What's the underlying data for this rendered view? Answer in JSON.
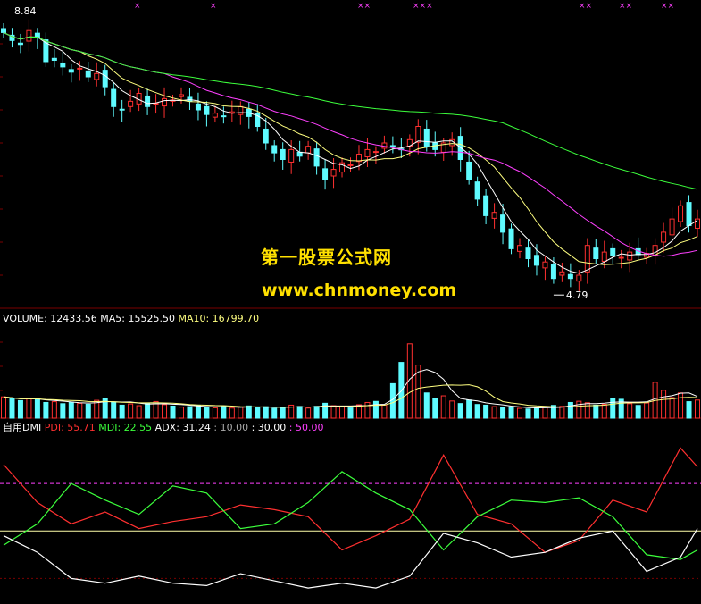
{
  "watermark": {
    "line1": "第一股票公式网",
    "line2": "www.chnmoney.com"
  },
  "colors": {
    "background": "#000000",
    "grid": "#7a0000",
    "up_candle": "#ff3030",
    "down_candle": "#5ffbff",
    "ma_short": "#ffffff",
    "ma_mid": "#ffff80",
    "ma_pink": "#ff40ff",
    "ma_long": "#3cff3c",
    "pdi": "#ff3030",
    "mdi": "#3cff3c",
    "adx": "#ffffff",
    "level_mid": "#ffffaa",
    "level_high": "#ff40ff",
    "level_low": "#ffffff"
  },
  "chart_data": [
    {
      "type": "candlestick",
      "panel": "price",
      "max_label": "8.84",
      "min_label": "4.79",
      "ylim": [
        4.55,
        9.05
      ],
      "grid": true,
      "signal_marks": [
        "×",
        "×",
        "××",
        "×××",
        "××",
        "××",
        "××"
      ],
      "close": [
        8.72,
        8.6,
        8.54,
        8.75,
        8.65,
        8.28,
        8.3,
        8.2,
        8.12,
        8.18,
        8.05,
        8.1,
        7.9,
        7.6,
        7.55,
        7.68,
        7.8,
        7.6,
        7.65,
        7.72,
        7.7,
        7.78,
        7.68,
        7.55,
        7.48,
        7.5,
        7.45,
        7.52,
        7.6,
        7.45,
        7.3,
        7.05,
        6.9,
        6.8,
        6.95,
        6.85,
        7.0,
        6.7,
        6.5,
        6.65,
        6.75,
        6.72,
        6.88,
        6.95,
        6.92,
        7.05,
        7.0,
        6.95,
        7.1,
        7.3,
        7.0,
        6.95,
        7.05,
        7.1,
        6.8,
        6.5,
        6.2,
        5.95,
        6.0,
        5.7,
        5.45,
        5.5,
        5.3,
        5.2,
        5.25,
        5.0,
        5.1,
        5.0,
        5.05,
        5.5,
        5.3,
        5.4,
        5.35,
        5.32,
        5.4,
        5.36,
        5.38,
        5.5,
        5.7,
        5.9,
        6.1,
        5.8,
        5.9
      ],
      "series": [
        {
          "name": "",
          "period": 5
        },
        {
          "name": "",
          "period": 10
        },
        {
          "name": "",
          "period": 20
        },
        {
          "name": "",
          "period": 60
        }
      ]
    },
    {
      "type": "bar",
      "panel": "volume",
      "header": {
        "name": "VOLUME: 12433.56",
        "ma5": "MA5: 15525.50",
        "ma10": "MA10: 16799.70"
      },
      "ylim": [
        0,
        70000
      ],
      "grid": true,
      "values": [
        16000,
        14500,
        13200,
        15100,
        13900,
        11800,
        12400,
        10900,
        12000,
        11200,
        10500,
        13400,
        14800,
        12100,
        9800,
        10700,
        9400,
        11300,
        12500,
        10200,
        9100,
        8300,
        8700,
        9600,
        8100,
        7800,
        8900,
        7600,
        8400,
        9200,
        7900,
        8600,
        7400,
        8100,
        9800,
        8800,
        7600,
        8900,
        11200,
        9400,
        8600,
        7700,
        10100,
        11800,
        12600,
        9900,
        26000,
        42000,
        56000,
        40000,
        19000,
        14500,
        16800,
        12900,
        11000,
        13600,
        10300,
        9800,
        8700,
        7900,
        8600,
        7400,
        6900,
        7800,
        8300,
        9600,
        8900,
        11800,
        12700,
        11600,
        9800,
        10400,
        15000,
        14200,
        10900,
        9600,
        11400,
        27000,
        21000,
        15500,
        19000,
        12400,
        13600
      ],
      "series": [
        {
          "name": "",
          "period": 5
        },
        {
          "name": "",
          "period": 10
        }
      ]
    },
    {
      "type": "line",
      "panel": "dmi",
      "header": {
        "name": "自用DMI",
        "pdi": "PDI: 55.71",
        "mdi": "MDI: 22.55",
        "adx": "ADX: 31.24",
        "level_low": ": 10.00",
        "level_mid": ": 30.00",
        "level_high": ": 50.00"
      },
      "ylim": [
        0,
        70
      ],
      "levels": [
        10,
        30,
        50
      ],
      "x": [
        0,
        4,
        8,
        12,
        16,
        20,
        24,
        28,
        32,
        36,
        40,
        44,
        48,
        52,
        56,
        60,
        64,
        68,
        72,
        76,
        80,
        82
      ],
      "series": [
        {
          "name": "PDI",
          "values": [
            58,
            42,
            33,
            38,
            31,
            34,
            36,
            41,
            39,
            36,
            22,
            28,
            35,
            62,
            37,
            33,
            21,
            26,
            43,
            38,
            65,
            57
          ]
        },
        {
          "name": "MDI",
          "values": [
            24,
            33,
            50,
            43,
            37,
            49,
            46,
            31,
            33,
            42,
            55,
            46,
            39,
            22,
            36,
            43,
            42,
            44,
            36,
            20,
            18,
            22
          ]
        },
        {
          "name": "ADX",
          "values": [
            28,
            21,
            10,
            8,
            11,
            8,
            7,
            12,
            9,
            6,
            8,
            6,
            11,
            29,
            25,
            19,
            21,
            27,
            30,
            13,
            19,
            31
          ]
        }
      ]
    }
  ]
}
